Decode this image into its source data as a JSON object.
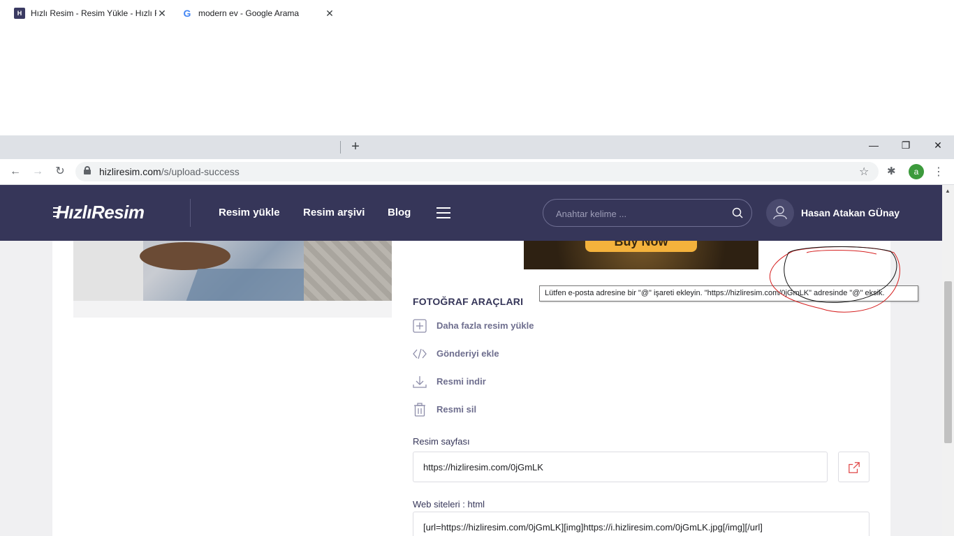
{
  "browser": {
    "tabs": [
      {
        "title": "Hızlı Resim - Resim Yükle - Hızlı Resim",
        "favicon": "H",
        "active": true
      },
      {
        "title": "modern ev - Google Arama",
        "favicon": "G",
        "active": false
      }
    ],
    "new_tab_label": "+",
    "window": {
      "minimize": "—",
      "restore": "❐",
      "close": "✕"
    },
    "nav": {
      "back": "←",
      "forward": "→",
      "reload": "↻"
    },
    "address": {
      "host": "hizliresim.com",
      "path": "/s/upload-success"
    },
    "profile_initial": "a",
    "colors": {
      "profile": "#3c9a3c"
    }
  },
  "site": {
    "logo": "HızlıResim",
    "nav": [
      "Resim yükle",
      "Resim arşivi",
      "Blog"
    ],
    "search_placeholder": "Anahtar kelime ...",
    "user_name": "Hasan Atakan GÜnay",
    "colors": {
      "header_bg": "#363659",
      "accent_text": "#6e6e8e"
    }
  },
  "ad": {
    "button_label": "Buy Now"
  },
  "tools": {
    "title": "FOTOĞRAF ARAÇLARI",
    "items": [
      {
        "label": "Daha fazla resim yükle",
        "icon": "plus-square-icon"
      },
      {
        "label": "Gönderiyi ekle",
        "icon": "code-icon"
      },
      {
        "label": "Resmi indir",
        "icon": "download-icon"
      },
      {
        "label": "Resmi sil",
        "icon": "trash-icon"
      }
    ]
  },
  "fields": {
    "page_label": "Resim sayfası",
    "page_value": "https://hizliresim.com/0jGmLK",
    "html_label": "Web siteleri : html",
    "html_value": "[url=https://hizliresim.com/0jGmLK][img]https://i.hizliresim.com/0jGmLK.jpg[/img][/url]"
  },
  "tooltip": "Lütfen e-posta adresine bir \"@\" işareti ekleyin. \"https://hizliresim.com/0jGmLK\" adresinde \"@\" eksik."
}
